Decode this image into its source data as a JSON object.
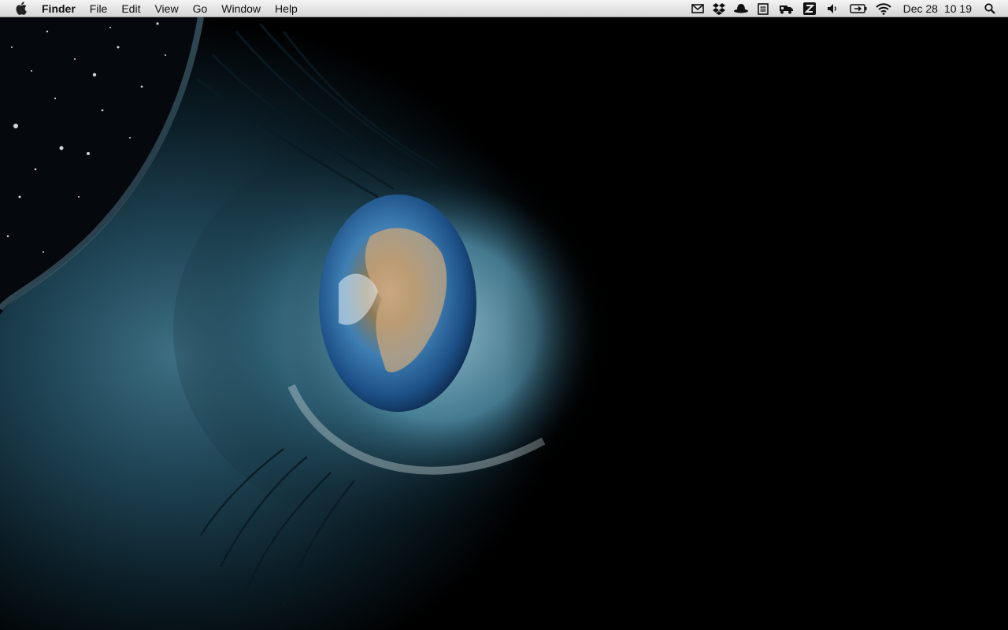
{
  "menubar": {
    "apple_icon": "apple-logo-icon",
    "app_name": "Finder",
    "menus": [
      "File",
      "Edit",
      "View",
      "Go",
      "Window",
      "Help"
    ],
    "status_icons": [
      "mail-icon",
      "dropbox-icon",
      "bowler-hat-icon",
      "notes-icon",
      "hardware-badge-icon",
      "z-badge-icon",
      "volume-icon",
      "battery-icon",
      "wifi-icon"
    ],
    "date": "Dec 28",
    "time": "10 19",
    "search_icon": "spotlight-search-icon"
  },
  "desktop": {
    "wallpaper": "eye-with-earth-reflection"
  },
  "colors": {
    "menubar_top": "#f4f4f4",
    "menubar_bottom": "#d6d6d6",
    "wallpaper_dark": "#000000",
    "iris_blue": "#2a6aa8"
  }
}
